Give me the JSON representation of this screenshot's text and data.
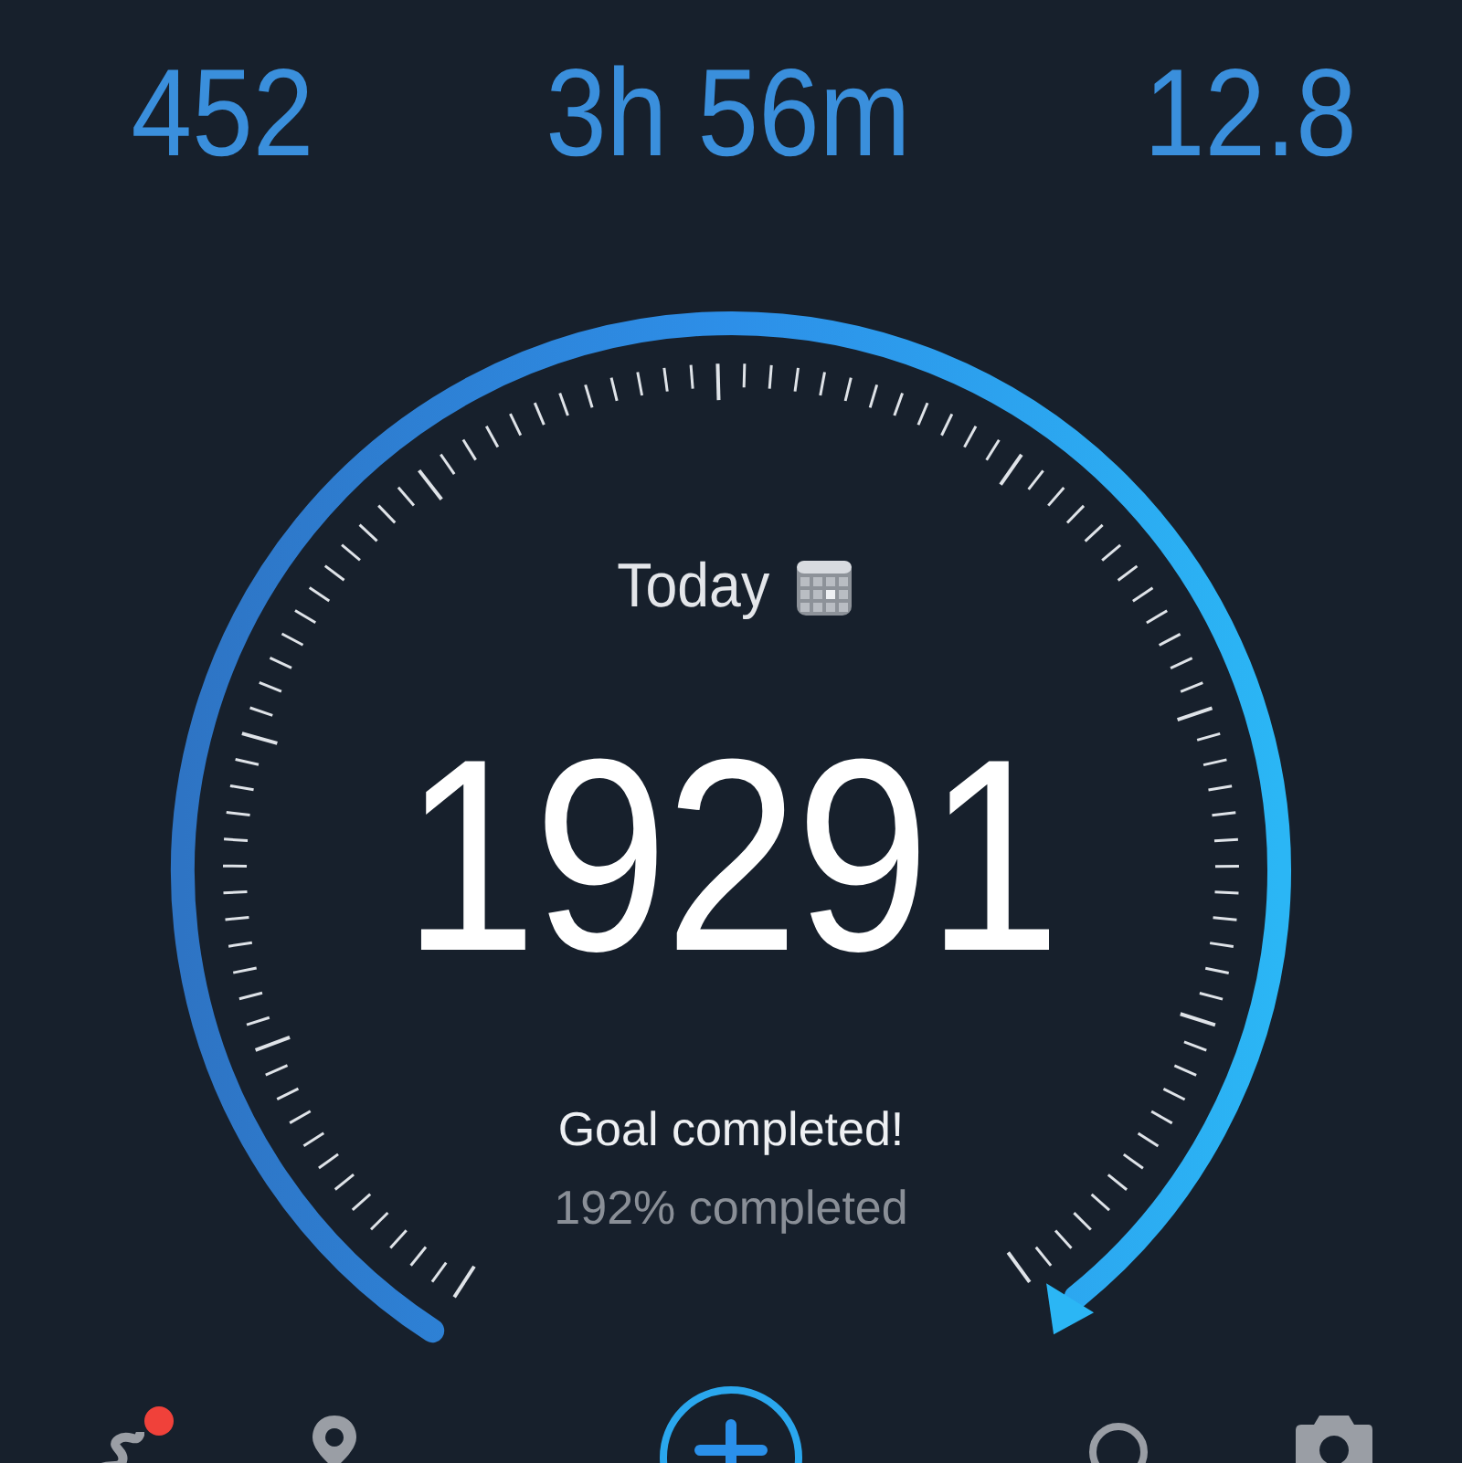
{
  "stats": [
    {
      "value": "452"
    },
    {
      "value": "3h 56m"
    },
    {
      "value": "12.8"
    }
  ],
  "gauge": {
    "period": "Today",
    "steps": "19291",
    "status": "Goal completed!",
    "percent": "192% completed"
  },
  "nav": [
    {
      "kind": "route",
      "badge": true
    },
    {
      "kind": "pin",
      "badge": false
    },
    {
      "kind": "add",
      "badge": false
    },
    {
      "kind": "search",
      "badge": false
    },
    {
      "kind": "camera",
      "badge": false
    }
  ]
}
